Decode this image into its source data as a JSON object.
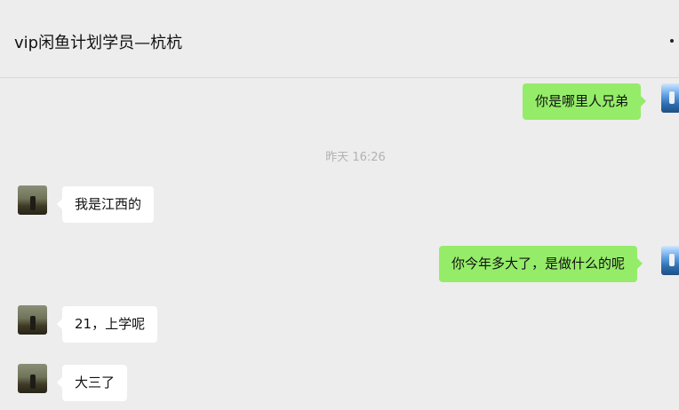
{
  "header": {
    "title": "vip闲鱼计划学员—杭杭",
    "more_icon": "more-dots-icon"
  },
  "chat": {
    "timestamp": "昨天 16:26",
    "messages": [
      {
        "side": "right",
        "text": "你是哪里人兄弟"
      },
      {
        "side": "left",
        "text": "我是江西的"
      },
      {
        "side": "right",
        "text": "你今年多大了，是做什么的呢"
      },
      {
        "side": "left",
        "text": "21，上学呢"
      },
      {
        "side": "left",
        "text": "大三了"
      }
    ]
  },
  "colors": {
    "background": "#ededed",
    "sent_bubble": "#95ec69",
    "received_bubble": "#ffffff",
    "timestamp_text": "#b2b2b2"
  }
}
